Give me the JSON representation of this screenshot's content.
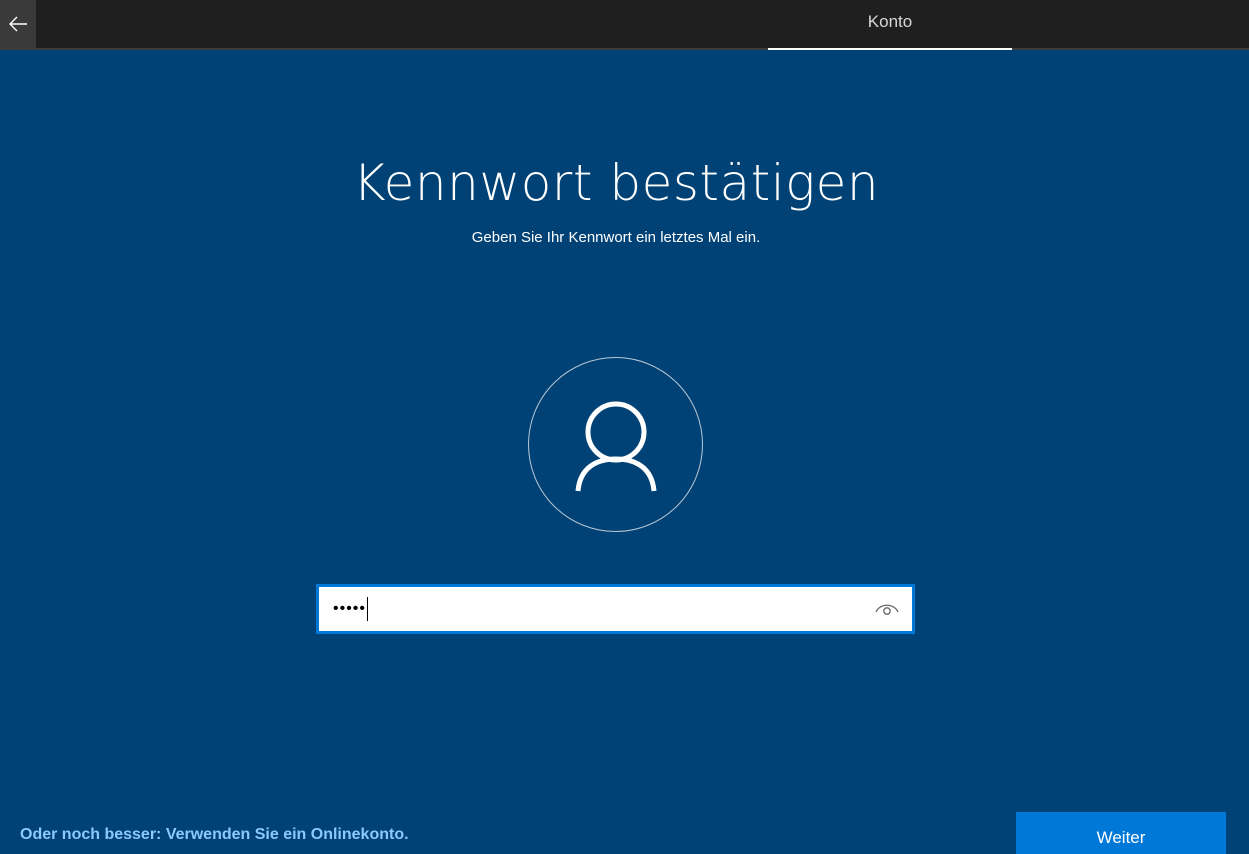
{
  "header": {
    "back_icon": "arrow-left-icon",
    "active_tab": "Konto"
  },
  "main": {
    "title": "Kennwort bestätigen",
    "subtitle": "Geben Sie Ihr Kennwort ein letztes Mal ein.",
    "avatar_icon": "user-icon",
    "password_field": {
      "value": "•••••",
      "reveal_icon": "eye-icon"
    }
  },
  "footer": {
    "online_account_link": "Oder noch besser: Verwenden Sie ein Onlinekonto.",
    "next_label": "Weiter"
  },
  "colors": {
    "background": "#004275",
    "topbar": "#1f1f1f",
    "accent": "#0078d7",
    "link": "#8cc8ff"
  }
}
